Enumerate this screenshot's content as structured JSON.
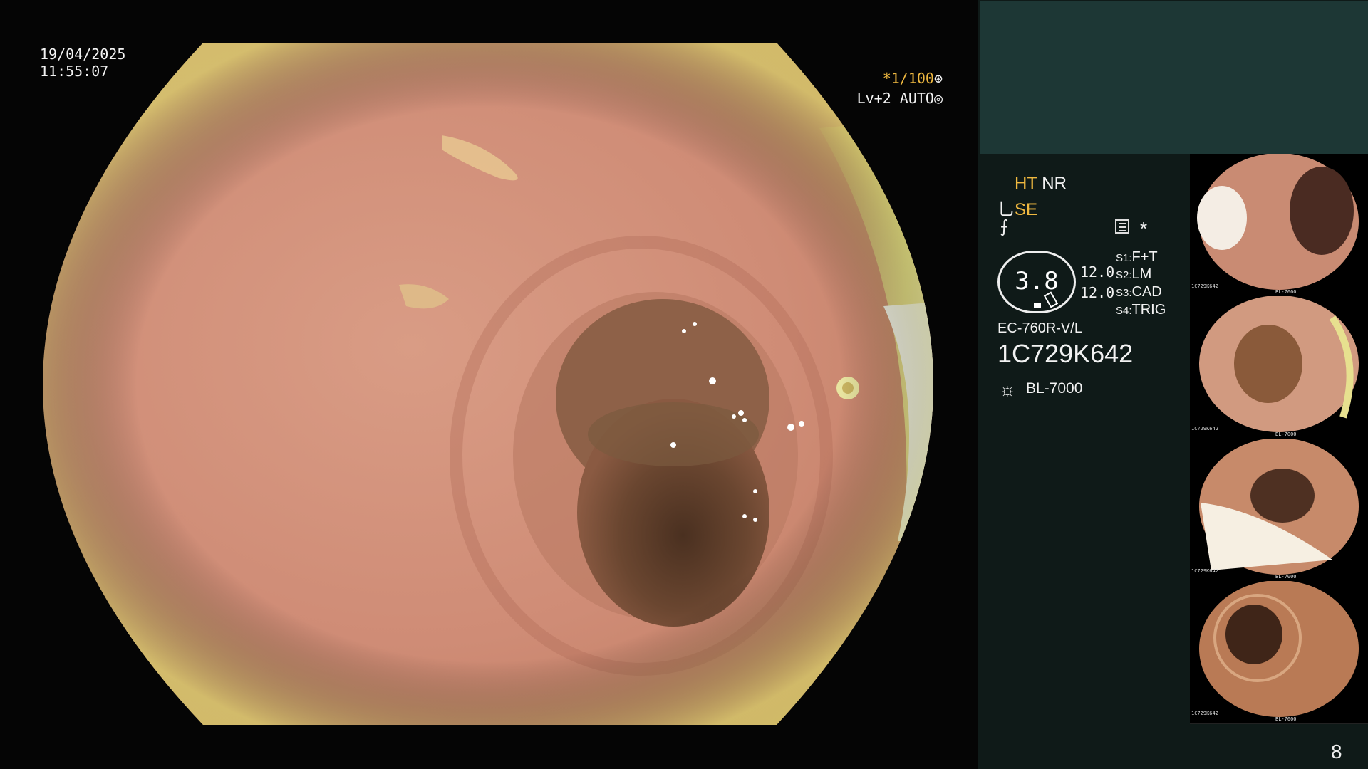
{
  "osd": {
    "date": "19/04/2025",
    "time": "11:55:07",
    "shutter": "*1/100",
    "level": "Lv+2 AUTO"
  },
  "panel": {
    "ht": "HT",
    "nr": "NR",
    "se": "SE",
    "zoom": "3.8",
    "val_a": "12.0",
    "val_b": "12.0",
    "switches": [
      {
        "key": "S1:",
        "value": "F+T"
      },
      {
        "key": "S2:",
        "value": "LM"
      },
      {
        "key": "S3:",
        "value": "CAD"
      },
      {
        "key": "S4:",
        "value": "TRIG"
      }
    ],
    "scope_model": "EC-760R-V/L",
    "serial": "1C729K642",
    "light_source": "BL-7000"
  },
  "thumbnails": [
    {
      "serial": "1C729K642",
      "light": "BL-7000"
    },
    {
      "serial": "1C729K642",
      "light": "BL-7000"
    },
    {
      "serial": "1C729K642",
      "light": "BL-7000"
    },
    {
      "serial": "1C729K642",
      "light": "BL-7000"
    }
  ],
  "page_number": "8",
  "colors": {
    "accent": "#f0b940",
    "panel_bg": "#0f1a18",
    "teal_box": "#1d3735"
  }
}
